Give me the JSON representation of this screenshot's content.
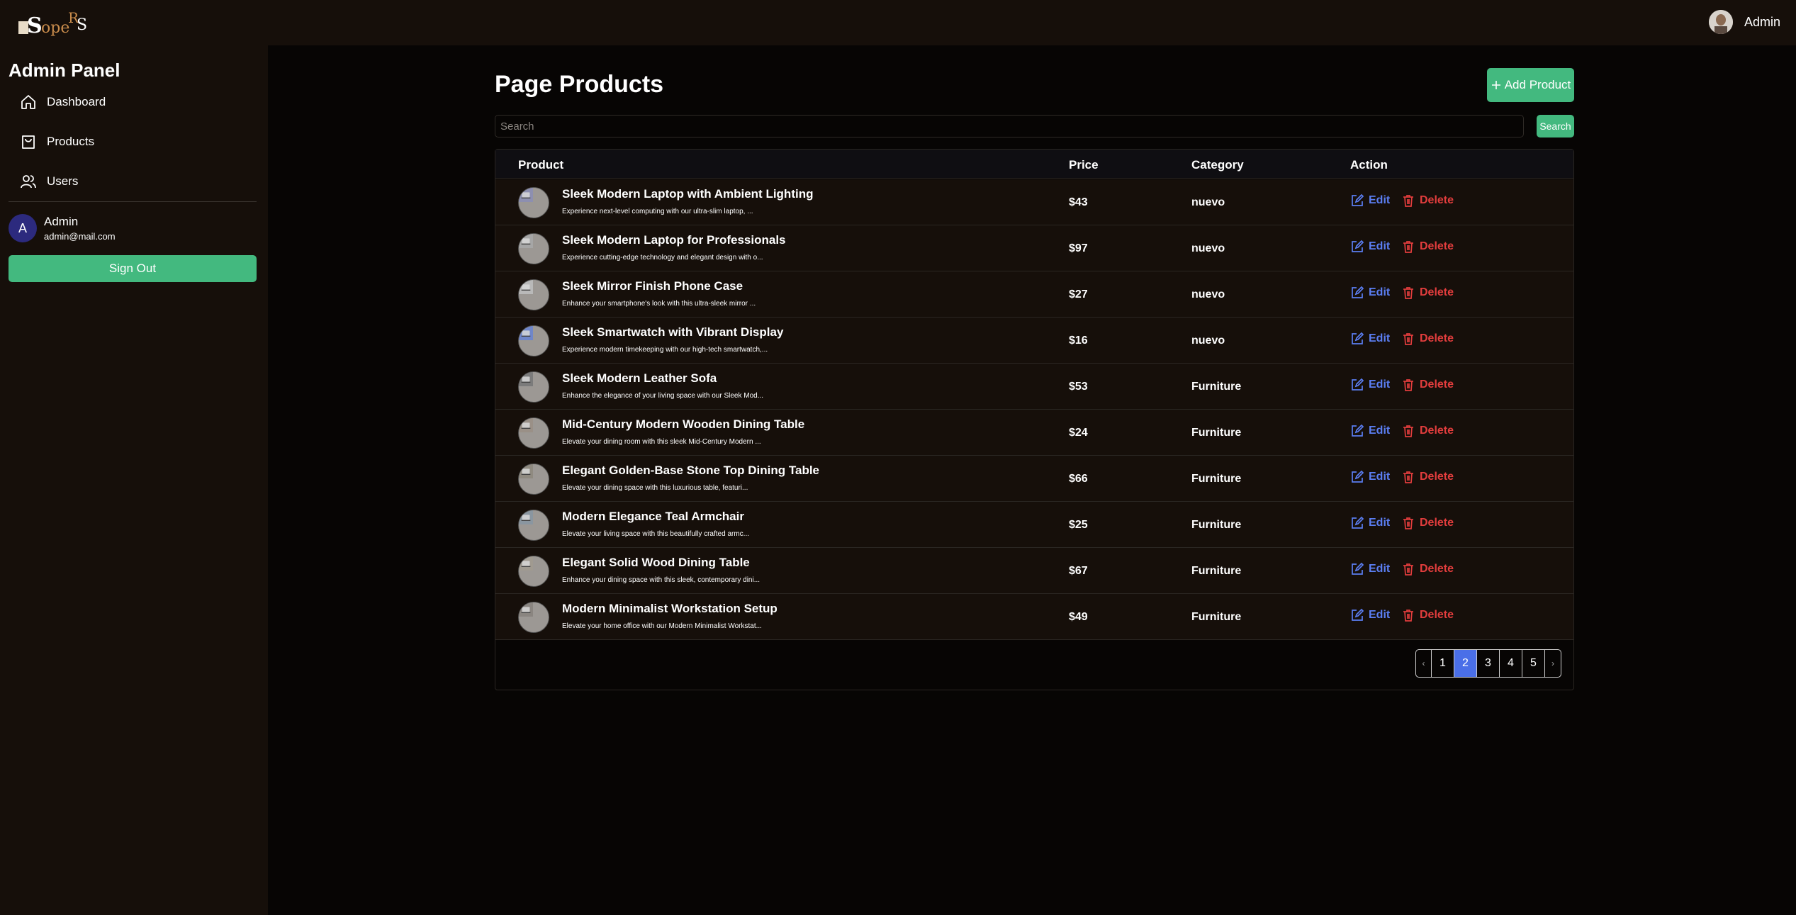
{
  "header": {
    "logo_text": "ShopeRS",
    "user_name": "Admin"
  },
  "sidebar": {
    "title": "Admin Panel",
    "items": [
      {
        "label": "Dashboard",
        "icon": "home-icon"
      },
      {
        "label": "Products",
        "icon": "shopping-bag-icon"
      },
      {
        "label": "Users",
        "icon": "users-icon"
      }
    ],
    "profile": {
      "initial": "A",
      "name": "Admin",
      "email": "admin@mail.com"
    },
    "sign_out_label": "Sign Out"
  },
  "main": {
    "title": "Page Products",
    "add_label": "Add Product",
    "search": {
      "placeholder": "Search",
      "value": "",
      "button_label": "Search"
    },
    "columns": [
      "Product",
      "Price",
      "Category",
      "Action"
    ],
    "actions": {
      "edit": "Edit",
      "delete": "Delete"
    },
    "products": [
      {
        "name": "Sleek Modern Laptop with Ambient Lighting",
        "desc": "Experience next-level computing with our ultra-slim laptop, ...",
        "price": "$43",
        "category": "nuevo"
      },
      {
        "name": "Sleek Modern Laptop for Professionals",
        "desc": "Experience cutting-edge technology and elegant design with o...",
        "price": "$97",
        "category": "nuevo"
      },
      {
        "name": "Sleek Mirror Finish Phone Case",
        "desc": "Enhance your smartphone's look with this ultra-sleek mirror ...",
        "price": "$27",
        "category": "nuevo"
      },
      {
        "name": "Sleek Smartwatch with Vibrant Display",
        "desc": "Experience modern timekeeping with our high-tech smartwatch,...",
        "price": "$16",
        "category": "nuevo"
      },
      {
        "name": "Sleek Modern Leather Sofa",
        "desc": "Enhance the elegance of your living space with our Sleek Mod...",
        "price": "$53",
        "category": "Furniture"
      },
      {
        "name": "Mid-Century Modern Wooden Dining Table",
        "desc": "Elevate your dining room with this sleek Mid-Century Modern ...",
        "price": "$24",
        "category": "Furniture"
      },
      {
        "name": "Elegant Golden-Base Stone Top Dining Table",
        "desc": "Elevate your dining space with this luxurious table, featuri...",
        "price": "$66",
        "category": "Furniture"
      },
      {
        "name": "Modern Elegance Teal Armchair",
        "desc": "Elevate your living space with this beautifully crafted armc...",
        "price": "$25",
        "category": "Furniture"
      },
      {
        "name": "Elegant Solid Wood Dining Table",
        "desc": "Enhance your dining space with this sleek, contemporary dini...",
        "price": "$67",
        "category": "Furniture"
      },
      {
        "name": "Modern Minimalist Workstation Setup",
        "desc": "Elevate your home office with our Modern Minimalist Workstat...",
        "price": "$49",
        "category": "Furniture"
      }
    ],
    "pagination": {
      "prev": "‹",
      "next": "›",
      "pages": [
        "1",
        "2",
        "3",
        "4",
        "5"
      ],
      "current": "2"
    }
  },
  "colors": {
    "accent_green": "#43b97f",
    "edit_blue": "#5b7ef2",
    "delete_red": "#e23d3d",
    "page_active": "#4a6fe8"
  }
}
